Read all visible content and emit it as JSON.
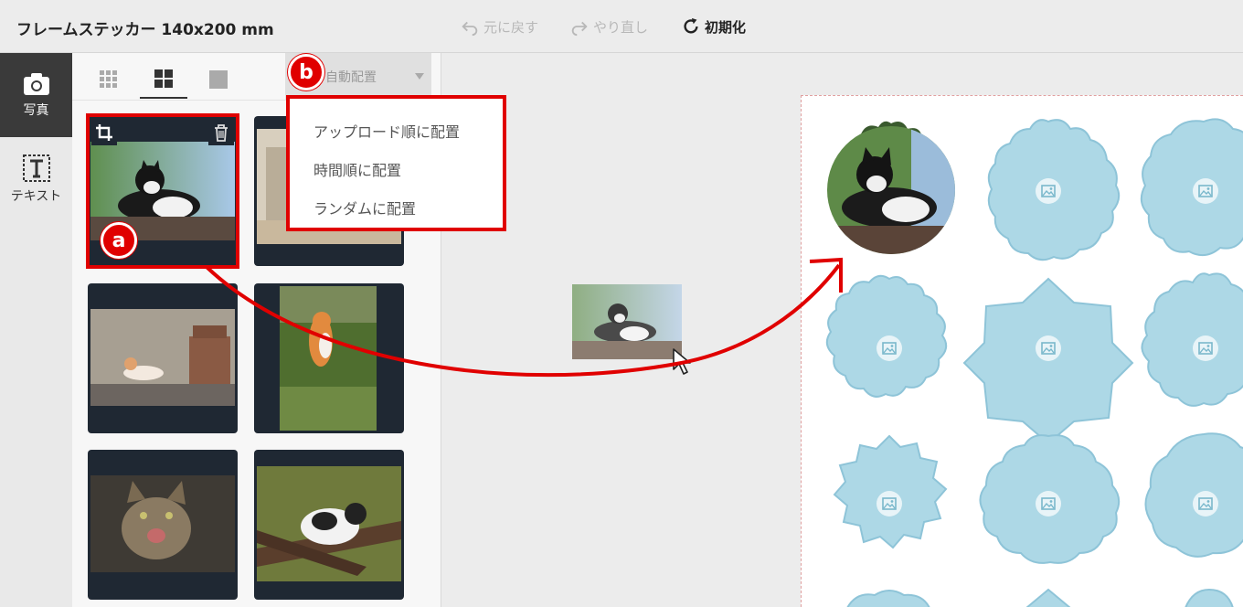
{
  "header": {
    "title": "フレームステッカー 140x200 mm",
    "undo_label": "元に戻す",
    "redo_label": "やり直し",
    "reset_label": "初期化"
  },
  "rail": {
    "photo_label": "写真",
    "text_label": "テキスト"
  },
  "panel": {
    "sort_label": "自動配置",
    "sort_options": [
      "アップロード順に配置",
      "時間順に配置",
      "ランダムに配置"
    ]
  },
  "annotations": {
    "a": "a",
    "b": "b"
  },
  "colors": {
    "accent_red": "#e00000",
    "sticker_blue": "#add8e6",
    "dark_thumb": "#1f2833"
  }
}
